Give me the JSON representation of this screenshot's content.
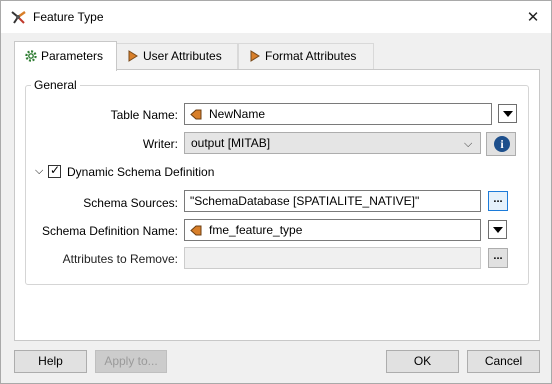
{
  "window": {
    "title": "Feature Type"
  },
  "tabs": [
    {
      "label": "Parameters",
      "icon": "gear-icon"
    },
    {
      "label": "User Attributes",
      "icon": "attribute-arrow-icon"
    },
    {
      "label": "Format Attributes",
      "icon": "attribute-arrow-icon"
    }
  ],
  "general": {
    "legend": "General",
    "table_name_label": "Table Name:",
    "table_name_value": "NewName",
    "writer_label": "Writer:",
    "writer_value": "output [MITAB]"
  },
  "dynamic_schema": {
    "title": "Dynamic Schema Definition",
    "checked": true,
    "schema_sources_label": "Schema Sources:",
    "schema_sources_value": "\"SchemaDatabase [SPATIALITE_NATIVE]\"",
    "schema_def_name_label": "Schema Definition Name:",
    "schema_def_name_value": "fme_feature_type",
    "attrs_to_remove_label": "Attributes to Remove:",
    "attrs_to_remove_value": "",
    "ellipsis": "..."
  },
  "buttons": {
    "help": "Help",
    "apply_to": "Apply to...",
    "ok": "OK",
    "cancel": "Cancel"
  },
  "colors": {
    "accent": "#1c7bd9",
    "info": "#1d4f8c",
    "attr_icon": "#d87f2a"
  }
}
